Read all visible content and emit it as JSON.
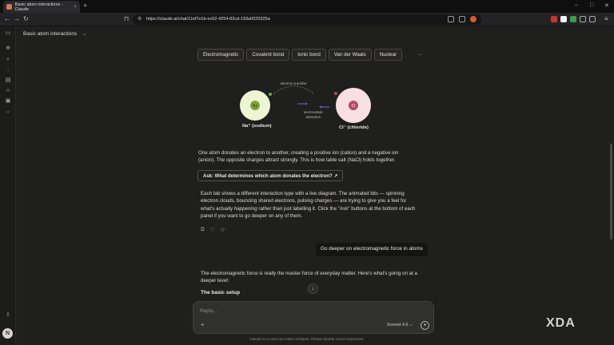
{
  "browser": {
    "tab_title": "Basic atom interactions - Claude",
    "tab_close": "×",
    "new_tab": "+",
    "url": "https://claude.ai/chat/11ef7e1b-ec62-4254-82cd-193a0020325a",
    "win_min": "–",
    "win_max": "□",
    "win_close": "✕"
  },
  "chat": {
    "title": "Basic atom interactions",
    "title_chevron": "⌄"
  },
  "interaction_tabs": [
    "Electromagnetic",
    "Covalent bond",
    "Ionic bond",
    "Van der Waals",
    "Nuclear"
  ],
  "more_label": "...",
  "diagram": {
    "left_atom_symbol": "Na",
    "left_atom_name": "Na⁺ (sodium)",
    "right_atom_symbol": "Cl",
    "right_atom_name": "Cl⁻ (chloride)",
    "transfer_label": "electron transfer",
    "attraction_label_1": "electrostatic",
    "attraction_label_2": "attraction",
    "colors": {
      "sodium_fill": "#eef5d4",
      "sodium_core": "#7ca33a",
      "chloride_fill": "#f7dfe2",
      "chloride_core": "#b04a66",
      "arrow": "#6c63c8"
    }
  },
  "messages": {
    "para1_line1": "One atom donates an electron to another, creating a positive ion (cation) and a negative ion",
    "para1_line2": "(anion). The opposite charges attract strongly. This is how table salt (NaCl) holds together.",
    "ask_button": "Ask: What determines which atom donates the electron? ↗",
    "para2_line1": "Each tab shows a different interaction type with a live diagram. The animated bits — spinning",
    "para2_line2": "electron clouds, bouncing shared electrons, pulsing charges — are trying to give you a feel for",
    "para2_line3_a": "what's actually ",
    "para2_line3_b": "happening",
    "para2_line3_c": " rather than just labelling it. Click the \"Ask\" buttons at the bottom of each",
    "para2_line4": "panel if you want to go deeper on any of them.",
    "user_message": "Go deeper on electromagnetic force in atoms",
    "para3_line1": "The electromagnetic force is really the master force of everyday matter. Here's what's going on at a",
    "para3_line2": "deeper level:",
    "heading": "The basic setup"
  },
  "composer": {
    "placeholder": "Reply...",
    "plus": "+",
    "model": "Sonnet 4.6 ⌄"
  },
  "disclaimer": "Claude is AI and can make mistakes. Please double-check responses.",
  "avatar_initial": "N",
  "watermark": "XDA"
}
